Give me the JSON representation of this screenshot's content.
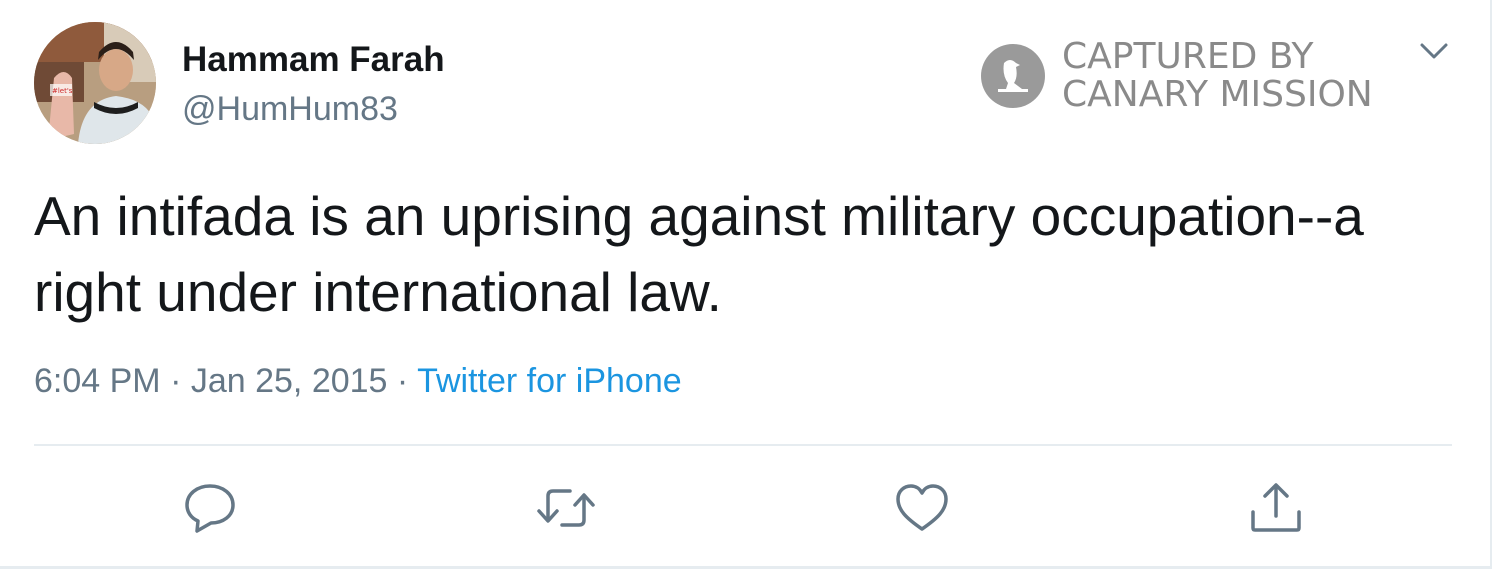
{
  "tweet": {
    "author_name": "Hammam Farah",
    "author_handle": "@HumHum83",
    "text": "An intifada is an uprising against military occupation--a right under international law.",
    "time": "6:04 PM",
    "separator1": " · ",
    "date": "Jan 25, 2015",
    "separator2": " · ",
    "source": "Twitter for iPhone"
  },
  "watermark": {
    "line1": "CAPTURED BY",
    "line2": "CANARY MISSION"
  },
  "actions": [
    "reply",
    "retweet",
    "like",
    "share"
  ],
  "colors": {
    "text": "#14171a",
    "secondary": "#657786",
    "link": "#1b95e0",
    "border": "#e6ecf0",
    "watermark": "#8a8a8a"
  }
}
